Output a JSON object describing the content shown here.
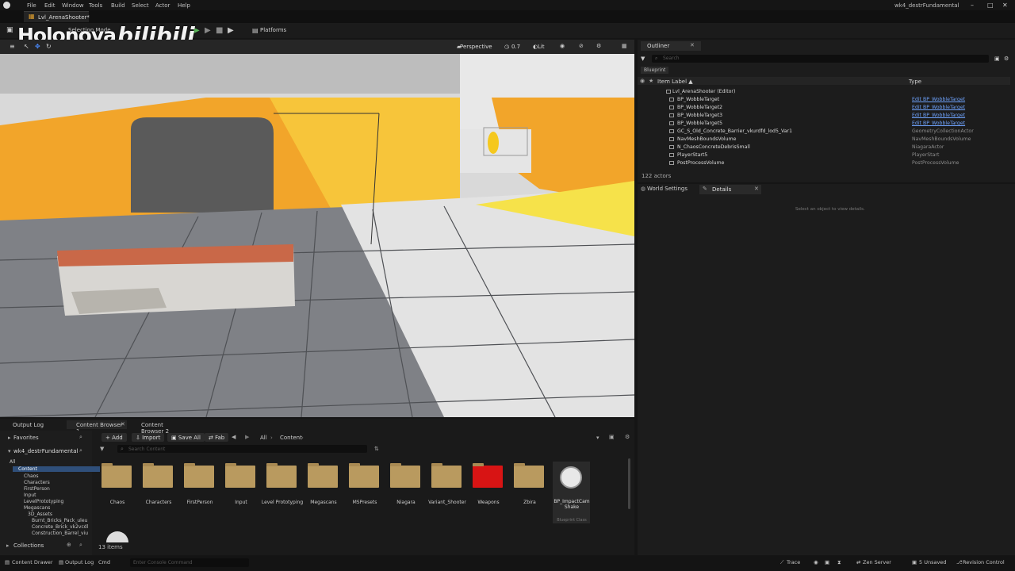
{
  "menu": {
    "items": [
      "File",
      "Edit",
      "Window",
      "Tools",
      "Build",
      "Select",
      "Actor",
      "Help"
    ]
  },
  "project_title": "wk4_destrFundamental",
  "level_tab": "Lvl_ArenaShooter*",
  "watermark": {
    "text": "Holonova",
    "brand": "bilibili"
  },
  "toolbar": {
    "selection_mode": "Selection Mode",
    "platforms": "Platforms"
  },
  "viewport": {
    "perspective": "Perspective",
    "speed": "0.7",
    "lit": "Lit"
  },
  "outliner": {
    "tab": "Outliner",
    "search_placeholder": "Search",
    "filter_chip": "Blueprint",
    "col_label": "Item Label ▲",
    "col_type": "Type",
    "root": "Lvl_ArenaShooter (Editor)",
    "rows": [
      {
        "label": "BP_WobbleTarget",
        "type": "Edit BP_WobbleTarget",
        "link": true
      },
      {
        "label": "BP_WobbleTarget2",
        "type": "Edit BP_WobbleTarget",
        "link": true
      },
      {
        "label": "BP_WobbleTarget3",
        "type": "Edit BP_WobbleTarget",
        "link": true
      },
      {
        "label": "BP_WobbleTarget5",
        "type": "Edit BP_WobbleTarget",
        "link": true
      },
      {
        "label": "GC_S_Old_Concrete_Barrier_vkurdfd_lod5_Var1",
        "type": "GeometryCollectionActor",
        "link": false
      },
      {
        "label": "NavMeshBoundsVolume",
        "type": "NavMeshBoundsVolume",
        "link": false
      },
      {
        "label": "N_ChaosConcreteDebrisSmall",
        "type": "NiagaraActor",
        "link": false
      },
      {
        "label": "PlayerStart5",
        "type": "PlayerStart",
        "link": false
      },
      {
        "label": "PostProcessVolume",
        "type": "PostProcessVolume",
        "link": false
      }
    ],
    "count": "122 actors"
  },
  "details": {
    "world_settings_tab": "World Settings",
    "tab": "Details",
    "empty_text": "Select an object to view details."
  },
  "bottom_tabs": {
    "output_log": "Output Log",
    "cb1": "Content Browser 1",
    "cb2": "Content Browser 2"
  },
  "content_browser": {
    "favorites": "Favorites",
    "project": "wk4_destrFundamental",
    "tree": [
      "All",
      "Content",
      "Chaos",
      "Characters",
      "FirstPerson",
      "Input",
      "LevelPrototyping",
      "Megascans",
      "3D_Assets",
      "Burnt_Bricks_Pack_uleu",
      "Concrete_Brick_vk2vcdl",
      "Construction_Barrel_viu"
    ],
    "buttons": {
      "add": "Add",
      "import": "Import",
      "save_all": "Save All",
      "fab": "Fab"
    },
    "crumbs": [
      "All",
      "Content"
    ],
    "search_placeholder": "Search Content",
    "folders": [
      "Chaos",
      "Characters",
      "FirstPerson",
      "Input",
      "Level Prototyping",
      "Megascans",
      "MSPresets",
      "Niagara",
      "Variant_Shooter",
      "Weapons",
      "Zbira"
    ],
    "asset": {
      "name": "BP_ImpactCam Shake",
      "type": "Blueprint Class"
    },
    "items_count": "13 items",
    "collections": "Collections"
  },
  "statusbar": {
    "content_drawer": "Content Drawer",
    "output_log": "Output Log",
    "cmd": "Cmd",
    "cmd_placeholder": "Enter Console Command",
    "trace": "Trace",
    "zen_server": "Zen Server",
    "unsaved": "5 Unsaved",
    "revision_control": "Revision Control"
  },
  "colors": {
    "accent_orange": "#f2a52a",
    "accent_yellow": "#f5c81e",
    "folder": "#b99a5f",
    "weapons_folder": "#d81414",
    "link_blue": "#6fa4ff"
  }
}
